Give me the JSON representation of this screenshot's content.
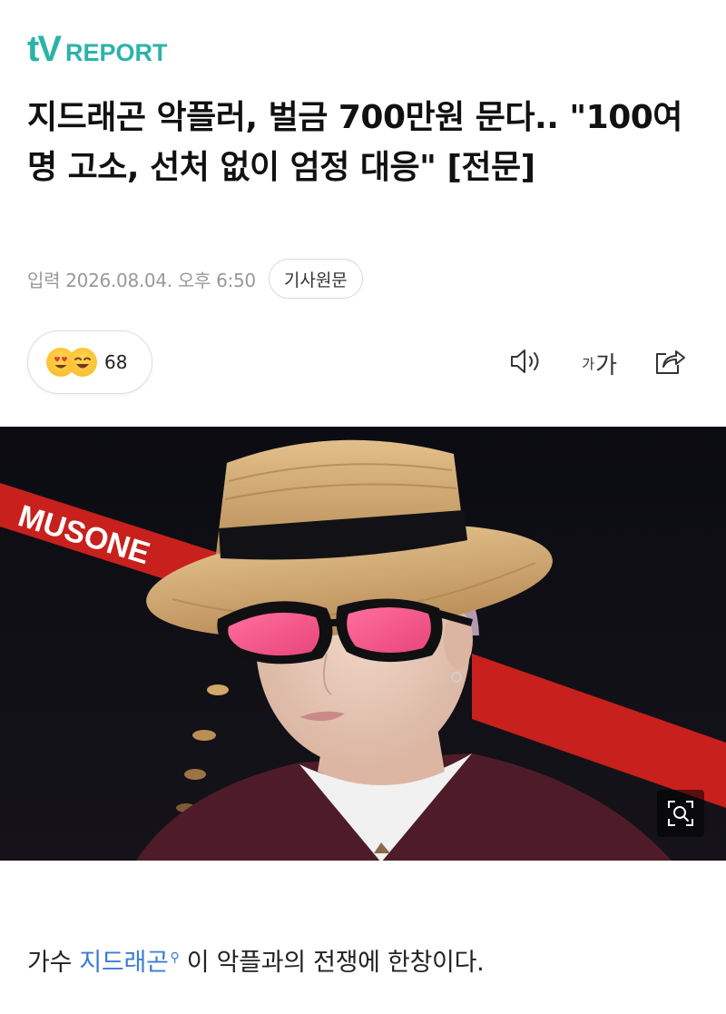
{
  "brand": {
    "logo_t": "t",
    "logo_v": "V",
    "logo_report": "REPORT",
    "color": "#2bb3a8"
  },
  "article": {
    "headline": "지드래곤 악플러, 벌금 700만원 문다.. \"100여명 고소, 선처 없이 엄정 대응\" [전문]",
    "published": "입력 2026.08.04. 오후 6:50",
    "original_button": "기사원문"
  },
  "reactions": {
    "emojis": [
      "heart-eyes-emoji-icon",
      "laughing-emoji-icon"
    ],
    "count": "68"
  },
  "toolbar": {
    "speaker_icon": "speaker-icon",
    "font_small": "가",
    "font_big": "가",
    "share_icon": "share-icon"
  },
  "photo": {
    "zoom_icon": "zoom-search-icon",
    "sign_text": "MUSONE"
  },
  "body": {
    "prefix": "가수 ",
    "entity": "지드래곤",
    "suffix": " 이 악플과의 전쟁에 한창이다.",
    "link_color": "#3c7bd6"
  }
}
